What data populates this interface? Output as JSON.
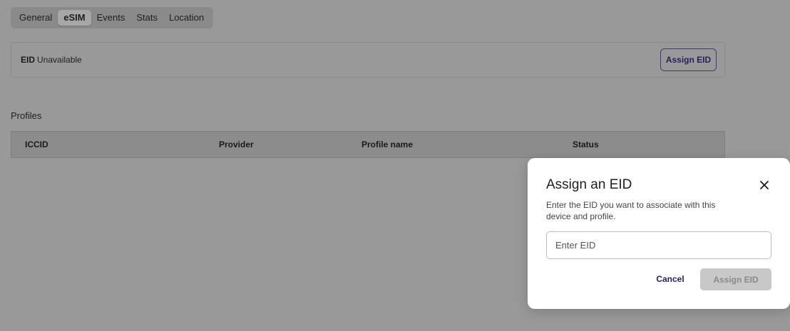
{
  "tabs": [
    {
      "label": "General"
    },
    {
      "label": "eSIM",
      "active": true
    },
    {
      "label": "Events"
    },
    {
      "label": "Stats"
    },
    {
      "label": "Location"
    }
  ],
  "eid": {
    "label": "EID",
    "value": "Unavailable",
    "assign_button": "Assign EID"
  },
  "profiles": {
    "title": "Profiles",
    "columns": [
      "ICCID",
      "Provider",
      "Profile name",
      "Status"
    ]
  },
  "modal": {
    "title": "Assign an EID",
    "description": "Enter the EID you want to associate with this device and profile.",
    "input_placeholder": "Enter EID",
    "input_value": "",
    "cancel_label": "Cancel",
    "submit_label": "Assign EID",
    "submit_disabled": true,
    "close_icon": "close-icon"
  },
  "colors": {
    "overlay": "#999999",
    "accent_text": "#2a1f5a",
    "modal_bg": "#ffffff",
    "disabled_button": "#c8c8c8"
  }
}
